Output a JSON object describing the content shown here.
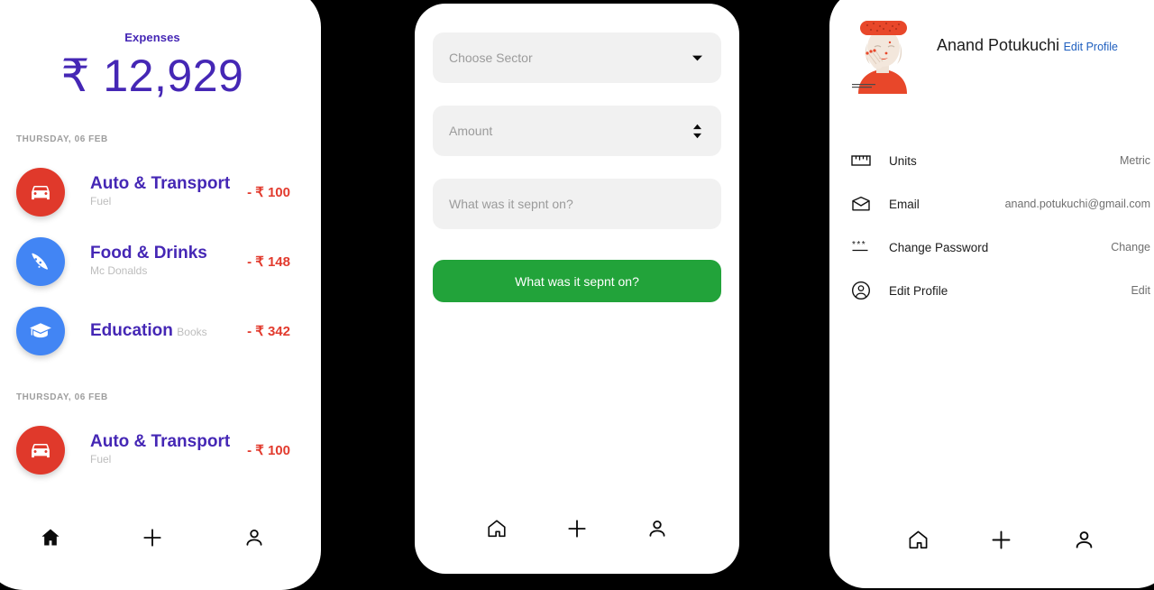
{
  "theme": {
    "background": "#000000",
    "card": "#ffffff",
    "accent_purple": "#4527b5",
    "amount_red": "#e23b2e",
    "button_green": "#22a33a",
    "field_grey": "#f1f1f1",
    "link_blue": "#1f5fbf"
  },
  "screens": {
    "home": {
      "header": {
        "label": "Expenses",
        "total": "₹ 12,929"
      },
      "groups": [
        {
          "date": "THURSDAY, 06 FEB",
          "transactions": [
            {
              "icon": "car-icon",
              "icon_color": "#e0392b",
              "title": "Auto & Transport",
              "subtitle": "Fuel",
              "amount": "- ₹ 100"
            },
            {
              "icon": "pizza-icon",
              "icon_color": "#4285f4",
              "title": "Food & Drinks",
              "subtitle": "Mc Donalds",
              "amount": "- ₹ 148"
            },
            {
              "icon": "graduation-cap-icon",
              "icon_color": "#4285f4",
              "title": "Education",
              "subtitle": "Books",
              "amount": "- ₹ 342"
            }
          ]
        },
        {
          "date": "THURSDAY, 06 FEB",
          "transactions": [
            {
              "icon": "car-icon",
              "icon_color": "#e0392b",
              "title": "Auto & Transport",
              "subtitle": "Fuel",
              "amount": "- ₹ 100"
            }
          ]
        }
      ],
      "nav": {
        "home_label": "home-icon",
        "add_label": "plus-icon",
        "profile_label": "person-icon",
        "active": "home"
      }
    },
    "add_expense": {
      "fields": [
        {
          "name": "sector-select",
          "placeholder": "Choose Sector",
          "value": "",
          "adornment": "chevron-down-icon"
        },
        {
          "name": "amount-input",
          "placeholder": "Amount",
          "value": "",
          "adornment": "stepper-icon"
        },
        {
          "name": "note-input",
          "placeholder": "What was it sepnt on?",
          "value": "",
          "adornment": "none"
        }
      ],
      "submit_label": "What was it sepnt on?",
      "nav": {
        "home_label": "home-icon",
        "add_label": "plus-icon",
        "profile_label": "person-icon",
        "active": "add"
      }
    },
    "profile": {
      "name": "Anand Potukuchi",
      "edit_link": "Edit Profile",
      "avatar_name": "profile-illustration",
      "settings": [
        {
          "icon": "ruler-icon",
          "label": "Units",
          "value": "Metric"
        },
        {
          "icon": "envelope-icon",
          "label": "Email",
          "value": "anand.potukuchi@gmail.com"
        },
        {
          "icon": "password-asterisks-icon",
          "label": "Change Password",
          "value": "Change"
        },
        {
          "icon": "person-circle-icon",
          "label": "Edit Profile",
          "value": "Edit"
        }
      ],
      "nav": {
        "home_label": "home-icon",
        "add_label": "plus-icon",
        "profile_label": "person-icon",
        "active": "profile"
      }
    }
  }
}
